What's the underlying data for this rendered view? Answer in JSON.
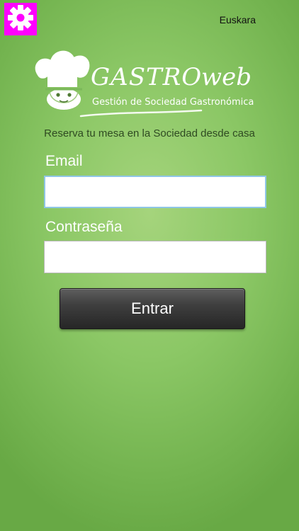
{
  "header": {
    "settings_icon": "gear-icon",
    "language_link": "Euskara"
  },
  "logo": {
    "brand_main": "GASTRO",
    "brand_web": "web",
    "subtitle": "Gestión de Sociedad Gastronómica",
    "icon": "chef-hat-icon"
  },
  "tagline": "Reserva tu mesa en la Sociedad desde casa",
  "form": {
    "email_label": "Email",
    "email_value": "",
    "password_label": "Contraseña",
    "password_value": "",
    "submit_label": "Entrar"
  },
  "colors": {
    "settings_bg": "#ff00ff",
    "background": "#8bc765",
    "button": "#333333"
  }
}
